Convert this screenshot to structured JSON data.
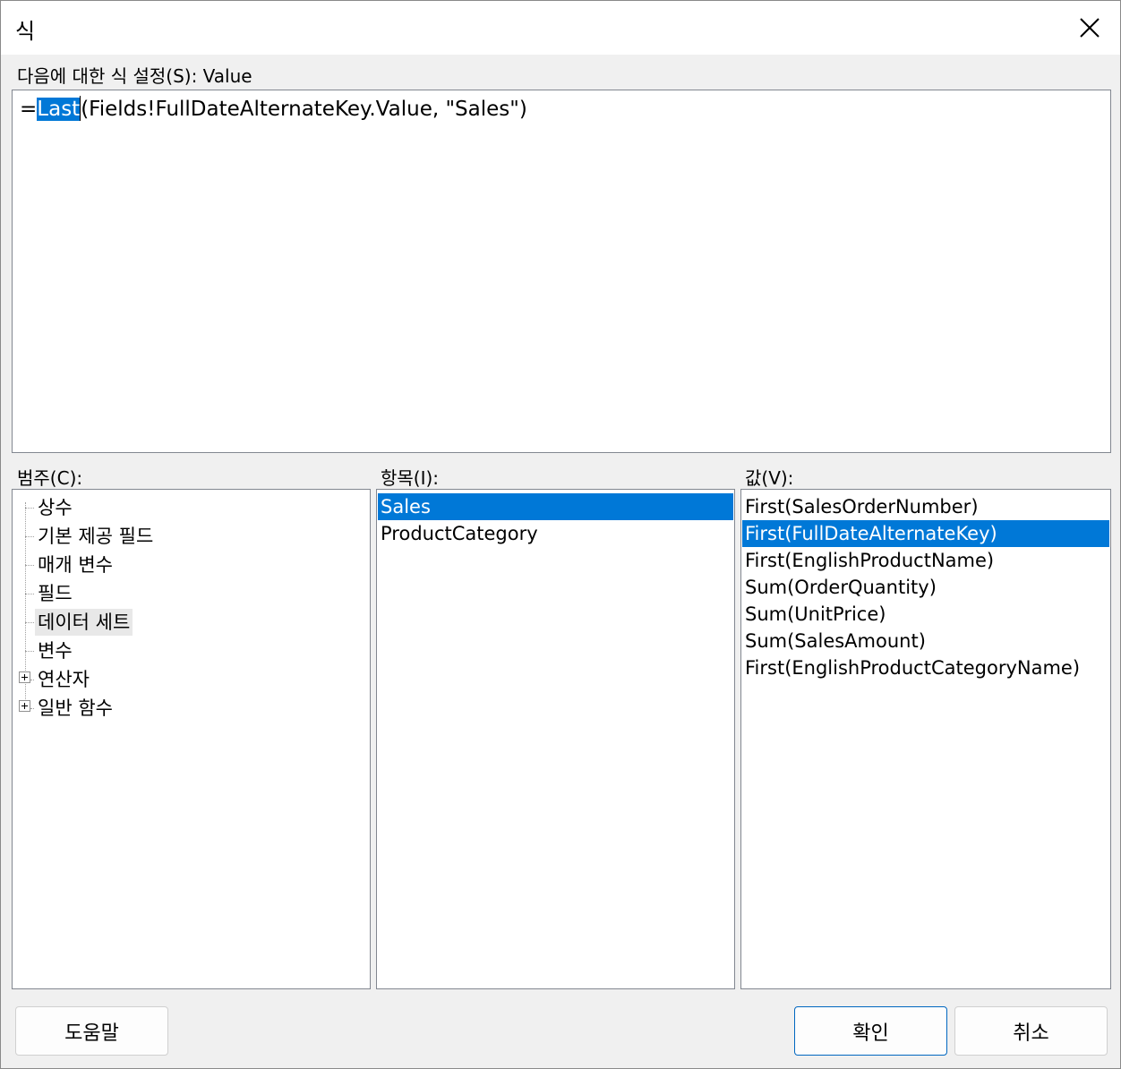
{
  "dialog": {
    "title": "식",
    "expression_label": "다음에 대한 식 설정(S): Value",
    "expression": {
      "prefix": "=",
      "selected_text": "Last",
      "rest": "(Fields!FullDateAlternateKey.Value, \"Sales\")"
    }
  },
  "category": {
    "label": "범주(C):",
    "items": [
      {
        "label": "상수"
      },
      {
        "label": "기본 제공 필드"
      },
      {
        "label": "매개 변수"
      },
      {
        "label": "필드"
      },
      {
        "label": "데이터 세트"
      },
      {
        "label": "변수"
      },
      {
        "label": "연산자"
      },
      {
        "label": "일반 함수"
      }
    ],
    "focused_item": "데이터 세트"
  },
  "item": {
    "label": "항목(I):",
    "items": [
      {
        "label": "Sales"
      },
      {
        "label": "ProductCategory"
      }
    ],
    "selected_item": "Sales"
  },
  "value": {
    "label": "값(V):",
    "items": [
      {
        "label": "First(SalesOrderNumber)"
      },
      {
        "label": "First(FullDateAlternateKey)"
      },
      {
        "label": "First(EnglishProductName)"
      },
      {
        "label": "Sum(OrderQuantity)"
      },
      {
        "label": "Sum(UnitPrice)"
      },
      {
        "label": "Sum(SalesAmount)"
      },
      {
        "label": "First(EnglishProductCategoryName)"
      }
    ],
    "selected_item": "First(FullDateAlternateKey)"
  },
  "buttons": {
    "help": "도움말",
    "ok": "확인",
    "cancel": "취소"
  },
  "colors": {
    "selection": "#0078d7",
    "dialog_background": "#f0f0f0",
    "default_button_border": "#0067c0"
  },
  "icons": {
    "close": "close-icon",
    "expander": "plus-expander-icon"
  }
}
